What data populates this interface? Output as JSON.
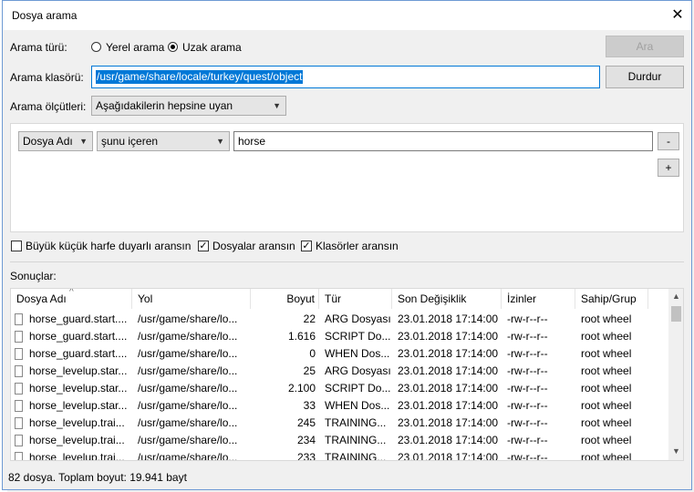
{
  "dialog": {
    "title": "Dosya arama",
    "close_glyph": "✕"
  },
  "search_type": {
    "label": "Arama türü:",
    "options": [
      "Yerel arama",
      "Uzak arama"
    ],
    "selected": "Uzak arama"
  },
  "search_folder": {
    "label": "Arama klasörü:",
    "value": "/usr/game/share/locale/turkey/quest/object"
  },
  "criteria": {
    "label": "Arama ölçütleri:",
    "match_value": "Aşağıdakilerin hepsine uyan",
    "rule": {
      "field": "Dosya Adı",
      "operator": "şunu içeren",
      "value": "horse"
    },
    "remove_label": "-",
    "add_label": "+"
  },
  "buttons": {
    "search": "Ara",
    "stop": "Durdur"
  },
  "options": [
    {
      "label": "Büyük küçük harfe duyarlı aransın",
      "checked": false
    },
    {
      "label": "Dosyalar aransın",
      "checked": true
    },
    {
      "label": "Klasörler aransın",
      "checked": true
    }
  ],
  "results": {
    "label": "Sonuçlar:",
    "sort_indicator": "^",
    "columns": [
      "Dosya Adı",
      "Yol",
      "Boyut",
      "Tür",
      "Son Değişiklik",
      "İzinler",
      "Sahip/Grup"
    ],
    "rows": [
      [
        "horse_guard.start....",
        "/usr/game/share/lo...",
        "22",
        "ARG Dosyası",
        "23.01.2018 17:14:00",
        "-rw-r--r--",
        "root wheel"
      ],
      [
        "horse_guard.start....",
        "/usr/game/share/lo...",
        "1.616",
        "SCRIPT Do...",
        "23.01.2018 17:14:00",
        "-rw-r--r--",
        "root wheel"
      ],
      [
        "horse_guard.start....",
        "/usr/game/share/lo...",
        "0",
        "WHEN Dos...",
        "23.01.2018 17:14:00",
        "-rw-r--r--",
        "root wheel"
      ],
      [
        "horse_levelup.star...",
        "/usr/game/share/lo...",
        "25",
        "ARG Dosyası",
        "23.01.2018 17:14:00",
        "-rw-r--r--",
        "root wheel"
      ],
      [
        "horse_levelup.star...",
        "/usr/game/share/lo...",
        "2.100",
        "SCRIPT Do...",
        "23.01.2018 17:14:00",
        "-rw-r--r--",
        "root wheel"
      ],
      [
        "horse_levelup.star...",
        "/usr/game/share/lo...",
        "33",
        "WHEN Dos...",
        "23.01.2018 17:14:00",
        "-rw-r--r--",
        "root wheel"
      ],
      [
        "horse_levelup.trai...",
        "/usr/game/share/lo...",
        "245",
        "TRAINING...",
        "23.01.2018 17:14:00",
        "-rw-r--r--",
        "root wheel"
      ],
      [
        "horse_levelup.trai...",
        "/usr/game/share/lo...",
        "234",
        "TRAINING...",
        "23.01.2018 17:14:00",
        "-rw-r--r--",
        "root wheel"
      ],
      [
        "horse_levelup.trai...",
        "/usr/game/share/lo...",
        "233",
        "TRAINING...",
        "23.01.2018 17:14:00",
        "-rw-r--r--",
        "root wheel"
      ]
    ]
  },
  "status": "82 dosya. Toplam boyut: 19.941 bayt"
}
